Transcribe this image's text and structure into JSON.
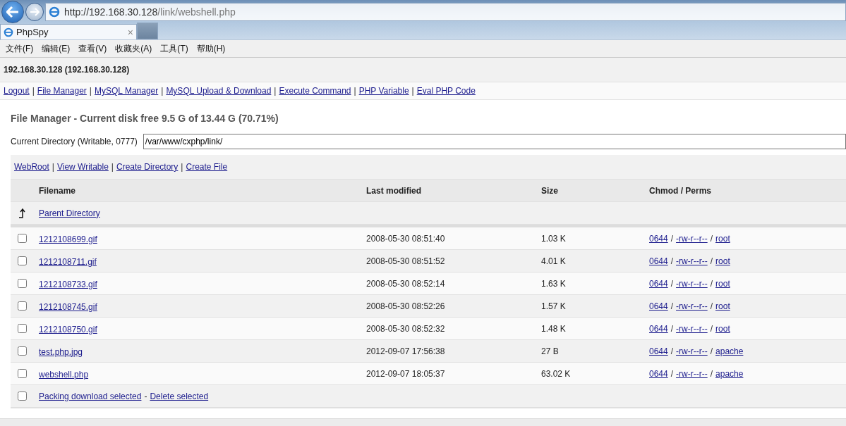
{
  "browser": {
    "url_host": "http://192.168.30.128",
    "url_path": "/link/webshell.php",
    "tab": {
      "title": "PhpSpy",
      "close": "×",
      "selected": true
    },
    "menu": [
      "文件(F)",
      "编辑(E)",
      "查看(V)",
      "收藏夹(A)",
      "工具(T)",
      "帮助(H)"
    ]
  },
  "host": "192.168.30.128 (192.168.30.128)",
  "separator": "|",
  "nav_links": [
    "Logout",
    "File Manager",
    "MySQL Manager",
    "MySQL Upload & Download",
    "Execute Command",
    "PHP Variable",
    "Eval PHP Code"
  ],
  "title": "File Manager - Current disk free 9.5 G of 13.44 G (70.71%)",
  "current_directory": {
    "label": "Current Directory (Writable, 0777)",
    "value": "/var/www/cxphp/link/"
  },
  "actions": [
    "WebRoot",
    "View Writable",
    "Create Directory",
    "Create File"
  ],
  "table": {
    "columns": [
      "Filename",
      "Last modified",
      "Size",
      "Chmod / Perms"
    ],
    "parent": "Parent Directory",
    "perm_separator": "/",
    "rows": [
      {
        "name": "1212108699.gif",
        "modified": "2008-05-30 08:51:40",
        "size": "1.03 K",
        "chmod": "0644",
        "perms": "-rw-r--r--",
        "owner": "root",
        "checked": false
      },
      {
        "name": "1212108711.gif",
        "modified": "2008-05-30 08:51:52",
        "size": "4.01 K",
        "chmod": "0644",
        "perms": "-rw-r--r--",
        "owner": "root",
        "checked": false
      },
      {
        "name": "1212108733.gif",
        "modified": "2008-05-30 08:52:14",
        "size": "1.63 K",
        "chmod": "0644",
        "perms": "-rw-r--r--",
        "owner": "root",
        "checked": false
      },
      {
        "name": "1212108745.gif",
        "modified": "2008-05-30 08:52:26",
        "size": "1.57 K",
        "chmod": "0644",
        "perms": "-rw-r--r--",
        "owner": "root",
        "checked": false
      },
      {
        "name": "1212108750.gif",
        "modified": "2008-05-30 08:52:32",
        "size": "1.48 K",
        "chmod": "0644",
        "perms": "-rw-r--r--",
        "owner": "root",
        "checked": false
      },
      {
        "name": "test.php.jpg",
        "modified": "2012-09-07 17:56:38",
        "size": "27 B",
        "chmod": "0644",
        "perms": "-rw-r--r--",
        "owner": "apache",
        "checked": false
      },
      {
        "name": "webshell.php",
        "modified": "2012-09-07 18:05:37",
        "size": "63.02 K",
        "chmod": "0644",
        "perms": "-rw-r--r--",
        "owner": "apache",
        "checked": false
      }
    ],
    "footer": {
      "checked": false,
      "download": "Packing download selected",
      "separator": "-",
      "delete": "Delete selected"
    }
  }
}
